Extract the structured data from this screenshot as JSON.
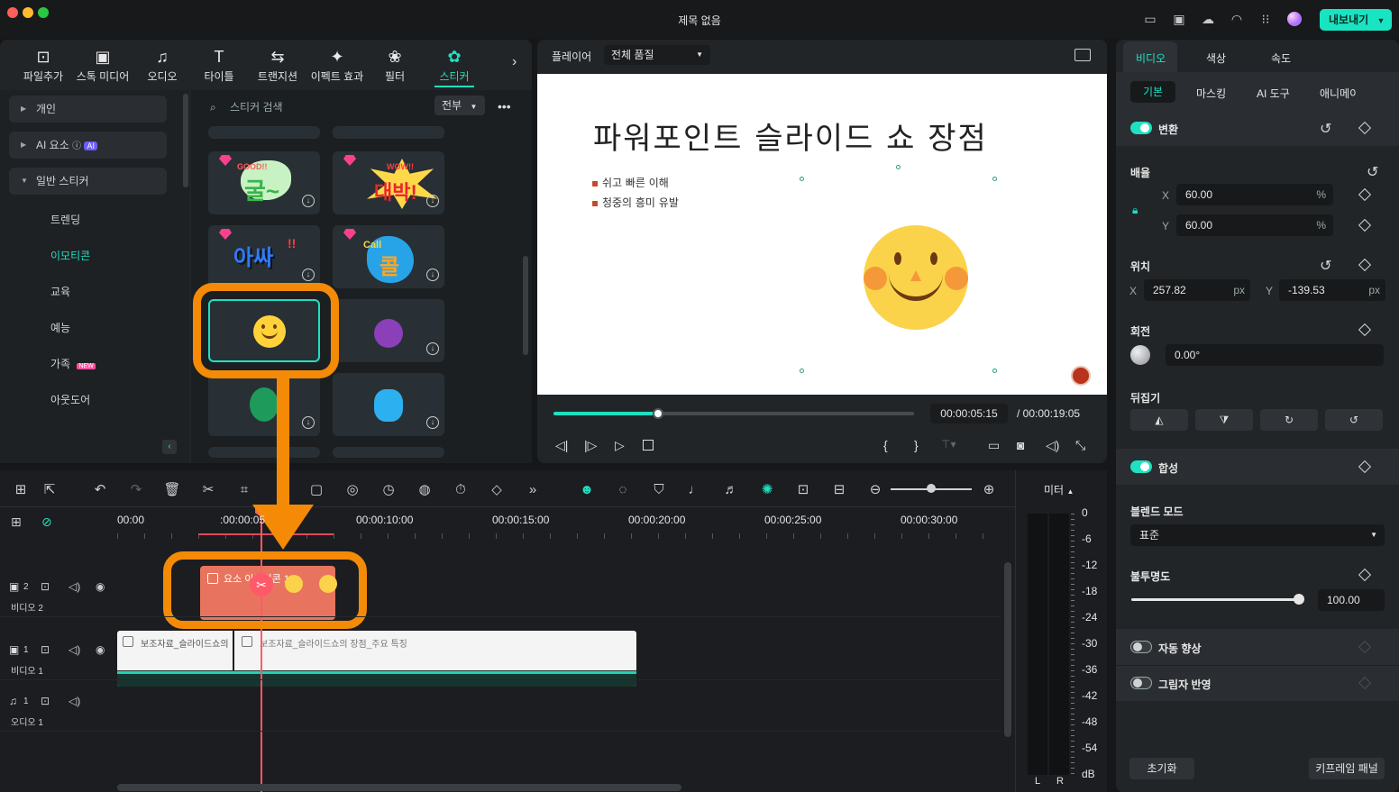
{
  "window": {
    "title": "제목 없음",
    "export_label": "내보내기"
  },
  "media_tabs": [
    {
      "label": "파일추가",
      "icon": "import-icon"
    },
    {
      "label": "스톡 미디어",
      "icon": "stock-media-icon"
    },
    {
      "label": "오디오",
      "icon": "music-note-icon"
    },
    {
      "label": "타이틀",
      "icon": "title-icon"
    },
    {
      "label": "트랜지션",
      "icon": "transition-icon"
    },
    {
      "label": "이펙트 효과",
      "icon": "effects-icon"
    },
    {
      "label": "필터",
      "icon": "filter-icon"
    },
    {
      "label": "스티커",
      "icon": "sticker-icon",
      "active": true
    }
  ],
  "categories": {
    "personal": "개인",
    "ai_elements": "AI 요소",
    "ai_badge": "AI",
    "general": "일반 스티커",
    "sub": [
      "트렌딩",
      "이모티콘",
      "교육",
      "예능",
      "가족",
      "아웃도어"
    ],
    "new_badge": "NEW",
    "active_sub": "이모티콘"
  },
  "search": {
    "placeholder": "스티커 검색",
    "filter": "전부"
  },
  "stickers": {
    "tile1": "굴~",
    "tile1_top": "GOOD!!",
    "tile2": "대박!",
    "tile2_top": "WOW!!",
    "tile3": "아싸",
    "tile4": "콜",
    "tile4_top": "Call"
  },
  "player": {
    "label": "플레이어",
    "quality": "전체 품질",
    "current_time": "00:00:05:15",
    "total_time": "/ 00:00:19:05",
    "progress": 0.29
  },
  "slide": {
    "title": "파워포인트 슬라이드 쇼 장점",
    "bullets": [
      "쉬고 빠른 이해",
      "청중의 흥미 유발"
    ]
  },
  "inspector": {
    "tabs": [
      "비디오",
      "색상",
      "속도"
    ],
    "subtabs": [
      "기본",
      "마스킹",
      "AI 도구",
      "애니메이"
    ],
    "transform": "변환",
    "scale": "배율",
    "scale_x": "60.00",
    "scale_y": "60.00",
    "pct": "%",
    "position": "위치",
    "pos_x": "257.82",
    "pos_y": "-139.53",
    "px": "px",
    "x": "X",
    "y": "Y",
    "rotation": "회전",
    "rotation_val": "0.00°",
    "flip": "뒤집기",
    "composite": "합성",
    "blend_mode": "블렌드 모드",
    "blend_value": "표준",
    "opacity": "불투명도",
    "opacity_val": "100.00",
    "opacity_level": 1.0,
    "auto_enhance": "자동 향상",
    "shadow": "그림자 반영",
    "reset": "초기화",
    "keyframe_panel": "키프레임 패널"
  },
  "timeline": {
    "ruler": [
      "00:00",
      ":00:00:05",
      "00:00:10:00",
      "00:00:15:00",
      "00:00:20:00",
      "00:00:25:00",
      "00:00:30:00"
    ],
    "tracks": [
      {
        "num": "2",
        "name": "비디오 2"
      },
      {
        "num": "1",
        "name": "비디오 1"
      },
      {
        "num": "1",
        "name": "오디오 1"
      }
    ],
    "sticker_clip": "요소 이모티콘 1",
    "video_clip": "보조자료_슬라이드쇼의 장점_주요 특징"
  },
  "meter": {
    "label": "미터",
    "scale": [
      "0",
      "-6",
      "-12",
      "-18",
      "-24",
      "-30",
      "-36",
      "-42",
      "-48",
      "-54",
      "dB"
    ],
    "l": "L",
    "r": "R"
  }
}
